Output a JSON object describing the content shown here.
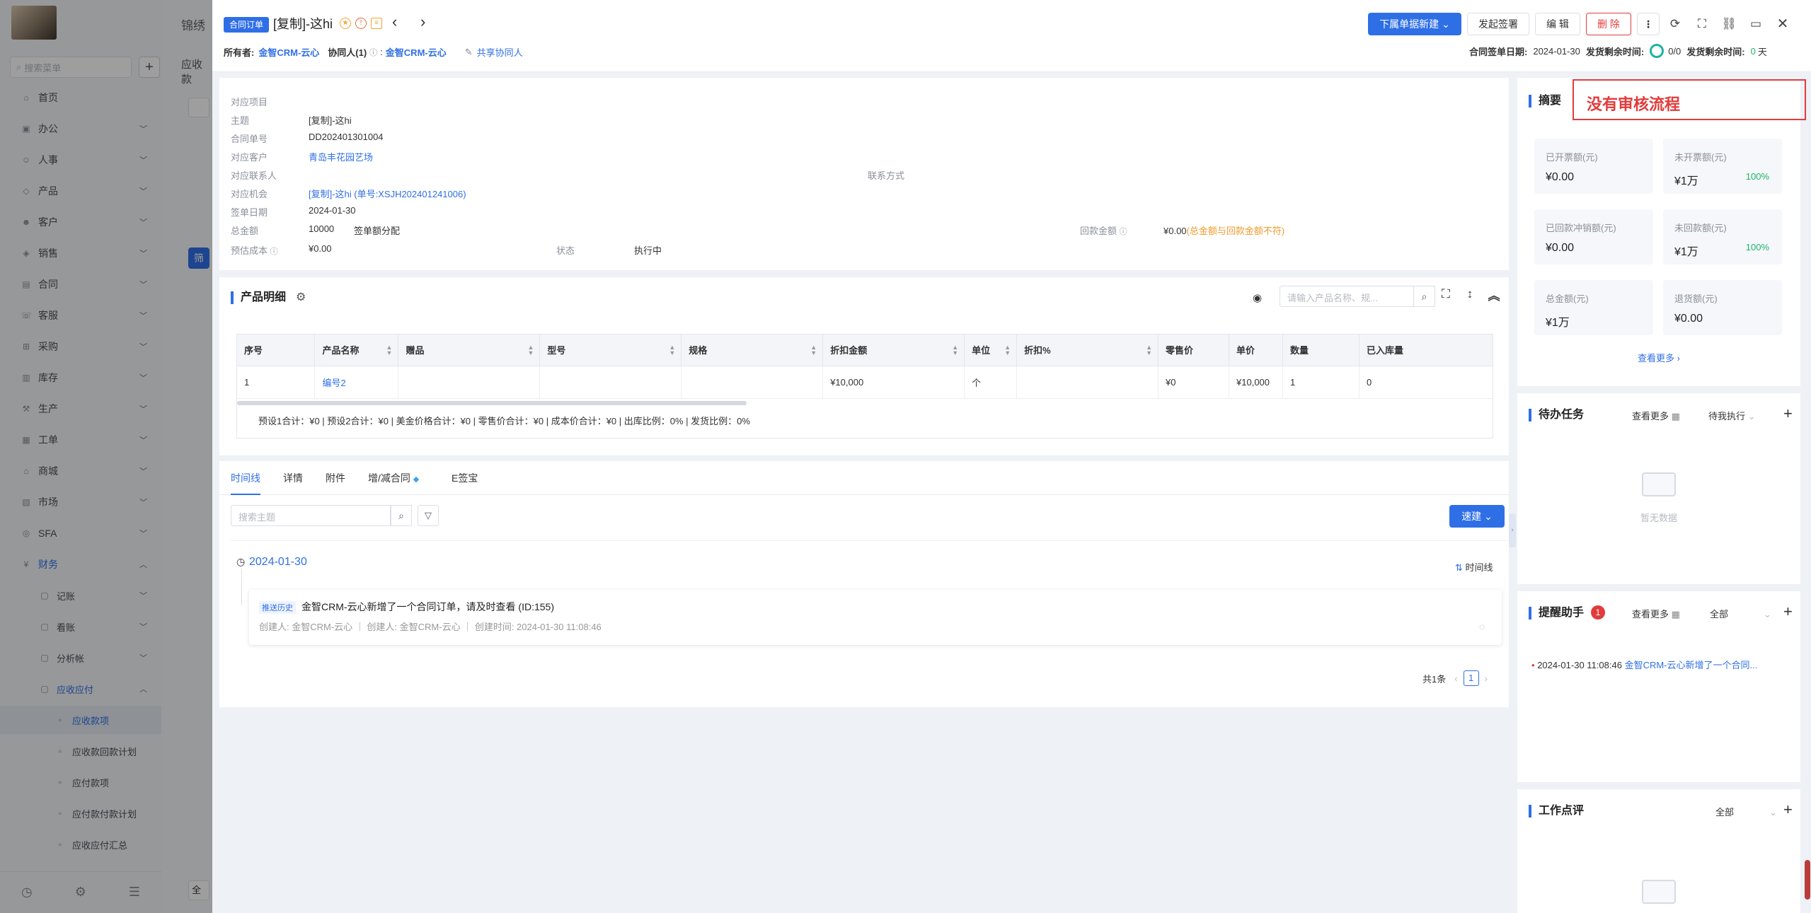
{
  "sidebar": {
    "search_placeholder": "搜索菜单",
    "items": [
      {
        "label": "首页",
        "icon": "home-icon"
      },
      {
        "label": "办公",
        "icon": "office-icon"
      },
      {
        "label": "人事",
        "icon": "people-icon"
      },
      {
        "label": "产品",
        "icon": "product-icon"
      },
      {
        "label": "客户",
        "icon": "customer-icon"
      },
      {
        "label": "销售",
        "icon": "sales-icon"
      },
      {
        "label": "合同",
        "icon": "contract-icon"
      },
      {
        "label": "客服",
        "icon": "service-icon"
      },
      {
        "label": "采购",
        "icon": "purchase-icon"
      },
      {
        "label": "库存",
        "icon": "stock-icon"
      },
      {
        "label": "生产",
        "icon": "production-icon"
      },
      {
        "label": "工单",
        "icon": "workorder-icon"
      },
      {
        "label": "商城",
        "icon": "shop-icon"
      },
      {
        "label": "市场",
        "icon": "market-icon"
      },
      {
        "label": "SFA",
        "icon": "sfa-icon"
      },
      {
        "label": "财务",
        "icon": "finance-icon"
      }
    ],
    "finance_sub": [
      {
        "label": "记账"
      },
      {
        "label": "看账"
      },
      {
        "label": "分析帐"
      },
      {
        "label": "应收应付"
      }
    ],
    "ar_sub": [
      {
        "label": "应收款项"
      },
      {
        "label": "应收款回款计划"
      },
      {
        "label": "应付款项"
      },
      {
        "label": "应付款付款计划"
      },
      {
        "label": "应收应付汇总"
      }
    ]
  },
  "background": {
    "header_fragment": "锦绣",
    "tab_fragment": "应收款",
    "btn_fragment": "筛",
    "bottom_fragment": "全"
  },
  "header": {
    "tag": "合同订单",
    "title": "[复制]-这hi",
    "owner_label": "所有者:",
    "owner": "金智CRM-云心",
    "collab_label": "协同人(1)",
    "collab_value": "金智CRM-云心",
    "share": "共享协同人",
    "btn_new": "下属单据新建",
    "btn_sign": "发起签署",
    "btn_edit": "编 辑",
    "btn_delete": "删 除",
    "sign_date_label": "合同签单日期:",
    "sign_date": "2024-01-30",
    "ship_remain_label1": "发货剩余时间:",
    "ship_ratio": "0/0",
    "ship_remain_label2": "发货剩余时间:",
    "ship_days": "0",
    "ship_days_unit": "天"
  },
  "info": {
    "project_label": "对应项目",
    "subject_label": "主题",
    "subject": "[复制]-这hi",
    "no_label": "合同单号",
    "no": "DD202401301004",
    "customer_label": "对应客户",
    "customer": "青岛丰花园艺场",
    "contact_label": "对应联系人",
    "contact_way_label": "联系方式",
    "chance_label": "对应机会",
    "chance": "[复制]-这hi (单号:XSJH202401241006)",
    "sign_date_label": "签单日期",
    "sign_date": "2024-01-30",
    "total_label": "总金额",
    "total": "10000",
    "total_split": "签单额分配",
    "refund_label": "回款金额",
    "refund": "¥0.00",
    "refund_note": "(总金额与回款金额不符)",
    "cost_label": "预估成本",
    "cost": "¥0.00",
    "status_label": "状态",
    "status": "执行中"
  },
  "products": {
    "title": "产品明细",
    "search_placeholder": "请输入产品名称、规...",
    "columns": [
      "序号",
      "产品名称",
      "赠品",
      "型号",
      "规格",
      "折扣金额",
      "单位",
      "折扣%",
      "零售价",
      "单价",
      "数量",
      "已入库量"
    ],
    "rows": [
      [
        "1",
        "编号2",
        "",
        "",
        "",
        "¥10,000",
        "个",
        "",
        "¥0",
        "¥10,000",
        "1",
        "0"
      ]
    ],
    "summary": "预设1合计：¥0 | 预设2合计：¥0 | 美金价格合计：¥0 | 零售价合计：¥0 | 成本价合计：¥0 | 出库比例：0% | 发货比例：0%"
  },
  "tabs": {
    "items": [
      "时间线",
      "详情",
      "附件",
      "增/减合同",
      "E签宝"
    ],
    "search_placeholder": "搜索主题",
    "quick_new": "速建",
    "date": "2024-01-30",
    "view": "时间线",
    "event_tag": "推送历史",
    "event_text": "金智CRM-云心新增了一个合同订单，请及时查看 (ID:155)",
    "creator1": "创建人: 金智CRM-云心",
    "creator2": "创建人: 金智CRM-云心",
    "created_time": "创建时间: 2024-01-30 11:08:46",
    "total": "共1条",
    "page": "1"
  },
  "summary": {
    "title": "摘要",
    "annotation": "没有审核流程",
    "cards": [
      {
        "label": "已开票额(元)",
        "value": "¥0.00",
        "pct": ""
      },
      {
        "label": "未开票额(元)",
        "value": "¥1万",
        "pct": "100%"
      },
      {
        "label": "已回款冲销额(元)",
        "value": "¥0.00",
        "pct": ""
      },
      {
        "label": "未回款额(元)",
        "value": "¥1万",
        "pct": "100%"
      },
      {
        "label": "总金额(元)",
        "value": "¥1万",
        "pct": ""
      },
      {
        "label": "退货额(元)",
        "value": "¥0.00",
        "pct": ""
      }
    ],
    "more": "查看更多"
  },
  "todo": {
    "title": "待办任务",
    "more": "查看更多",
    "filter": "待我执行",
    "empty": "暂无数据"
  },
  "reminder": {
    "title": "提醒助手",
    "badge": "1",
    "more": "查看更多",
    "filter": "全部",
    "item_time": "2024-01-30 11:08:46",
    "item_text": "金智CRM-云心新增了一个合同..."
  },
  "review": {
    "title": "工作点评",
    "filter": "全部"
  }
}
